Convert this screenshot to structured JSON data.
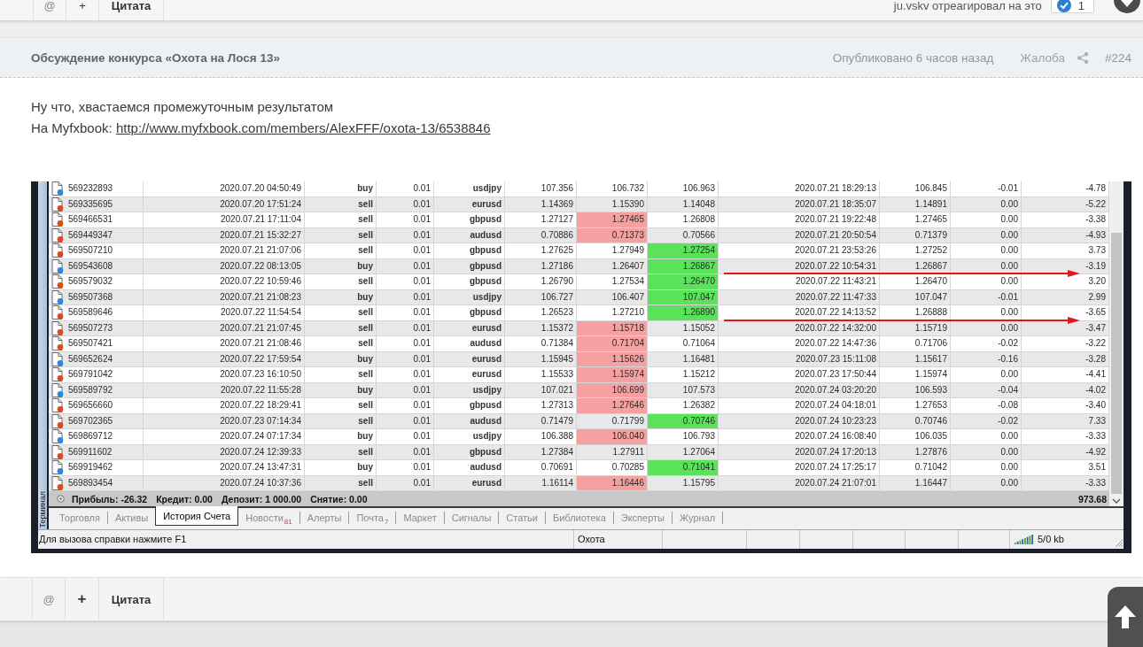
{
  "top_bar": {
    "buttons": [
      "@",
      "+",
      "Цитата"
    ],
    "reaction_text": "ju.vskv отреагировал на это",
    "reaction_count": "1"
  },
  "post": {
    "title": "Обсуждение конкурса «Охота на Лося 13»",
    "published": "Опубликовано 6 часов назад",
    "report_link": "Жалоба",
    "post_number": "#224",
    "paragraphs": [
      {
        "text": "Ну что, хвастаемся промежуточным результатом"
      },
      {
        "text": "На Myfxbook:",
        "link": "http://www.myfxbook.com/members/AlexFFF/oxota-13/6538846"
      }
    ]
  },
  "terminal": {
    "side_label": "Терминал",
    "rows": [
      {
        "kind": "buy",
        "cells": [
          "569232893",
          "2020.07.20 04:50:49",
          "buy",
          "0.01",
          "usdjpy",
          "107.356",
          "106.732",
          "106.963",
          "2020.07.21 18:29:13",
          "106.845",
          "-0.01",
          "-4.78"
        ],
        "column_7_highlighted": false,
        "column_8_highlighted": false,
        "arrow": false
      },
      {
        "kind": "sell",
        "cells": [
          "569335695",
          "2020.07.20 17:51:24",
          "sell",
          "0.01",
          "eurusd",
          "1.14369",
          "1.15390",
          "1.14048",
          "2020.07.21 18:35:07",
          "1.14891",
          "0.00",
          "-5.22"
        ],
        "column_7_highlighted": false,
        "column_8_highlighted": false,
        "arrow": false
      },
      {
        "kind": "sell",
        "cells": [
          "569466531",
          "2020.07.21 17:11:04",
          "sell",
          "0.01",
          "gbpusd",
          "1.27127",
          "1.27465",
          "1.26808",
          "2020.07.21 19:22:48",
          "1.27465",
          "0.00",
          "-3.38"
        ],
        "column_7_highlighted": true,
        "column_8_highlighted": false,
        "arrow": false
      },
      {
        "kind": "sell",
        "cells": [
          "569449347",
          "2020.07.21 15:32:27",
          "sell",
          "0.01",
          "audusd",
          "0.70886",
          "0.71373",
          "0.70566",
          "2020.07.21 20:50:54",
          "0.71379",
          "0.00",
          "-4.93"
        ],
        "column_7_highlighted": true,
        "column_8_highlighted": false,
        "arrow": false
      },
      {
        "kind": "sell",
        "cells": [
          "569507210",
          "2020.07.21 21:07:06",
          "sell",
          "0.01",
          "gbpusd",
          "1.27625",
          "1.27949",
          "1.27254",
          "2020.07.21 23:53:26",
          "1.27252",
          "0.00",
          "3.73"
        ],
        "column_7_highlighted": false,
        "column_8_highlighted": true,
        "arrow": false
      },
      {
        "kind": "buy",
        "cells": [
          "569543608",
          "2020.07.22 08:13:05",
          "buy",
          "0.01",
          "gbpusd",
          "1.27186",
          "1.26407",
          "1.26867",
          "2020.07.22 10:54:31",
          "1.26867",
          "0.00",
          "-3.19"
        ],
        "column_7_highlighted": false,
        "column_8_highlighted": true,
        "arrow": true
      },
      {
        "kind": "sell",
        "cells": [
          "569579032",
          "2020.07.22 10:59:46",
          "sell",
          "0.01",
          "gbpusd",
          "1.26790",
          "1.27534",
          "1.26470",
          "2020.07.22 11:43:21",
          "1.26470",
          "0.00",
          "3.20"
        ],
        "column_7_highlighted": false,
        "column_8_highlighted": true,
        "arrow": false
      },
      {
        "kind": "buy",
        "cells": [
          "569507368",
          "2020.07.21 21:08:23",
          "buy",
          "0.01",
          "usdjpy",
          "106.727",
          "106.407",
          "107.047",
          "2020.07.22 11:47:33",
          "107.047",
          "-0.01",
          "2.99"
        ],
        "column_7_highlighted": false,
        "column_8_highlighted": true,
        "arrow": false
      },
      {
        "kind": "sell",
        "cells": [
          "569589646",
          "2020.07.22 11:54:54",
          "sell",
          "0.01",
          "gbpusd",
          "1.26523",
          "1.27210",
          "1.26890",
          "2020.07.22 14:13:52",
          "1.26888",
          "0.00",
          "-3.65"
        ],
        "column_7_highlighted": false,
        "column_8_highlighted": true,
        "arrow": true
      },
      {
        "kind": "sell",
        "cells": [
          "569507273",
          "2020.07.21 21:07:45",
          "sell",
          "0.01",
          "eurusd",
          "1.15372",
          "1.15718",
          "1.15052",
          "2020.07.22 14:32:00",
          "1.15719",
          "0.00",
          "-3.47"
        ],
        "column_7_highlighted": true,
        "column_8_highlighted": false,
        "arrow": false
      },
      {
        "kind": "sell",
        "cells": [
          "569507421",
          "2020.07.21 21:08:46",
          "sell",
          "0.01",
          "audusd",
          "0.71384",
          "0.71704",
          "0.71064",
          "2020.07.22 14:47:36",
          "0.71706",
          "-0.02",
          "-3.22"
        ],
        "column_7_highlighted": true,
        "column_8_highlighted": false,
        "arrow": false
      },
      {
        "kind": "buy",
        "cells": [
          "569652624",
          "2020.07.22 17:59:54",
          "buy",
          "0.01",
          "eurusd",
          "1.15945",
          "1.15626",
          "1.16481",
          "2020.07.23 15:11:08",
          "1.15617",
          "-0.16",
          "-3.28"
        ],
        "column_7_highlighted": true,
        "column_8_highlighted": false,
        "arrow": false
      },
      {
        "kind": "sell",
        "cells": [
          "569791042",
          "2020.07.23 16:10:50",
          "sell",
          "0.01",
          "eurusd",
          "1.15533",
          "1.15974",
          "1.15212",
          "2020.07.23 17:50:44",
          "1.15974",
          "0.00",
          "-4.41"
        ],
        "column_7_highlighted": true,
        "column_8_highlighted": false,
        "arrow": false
      },
      {
        "kind": "buy",
        "cells": [
          "569589792",
          "2020.07.22 11:55:28",
          "buy",
          "0.01",
          "usdjpy",
          "107.021",
          "106.699",
          "107.573",
          "2020.07.24 03:20:20",
          "106.593",
          "-0.04",
          "-4.02"
        ],
        "column_7_highlighted": true,
        "column_8_highlighted": false,
        "arrow": false
      },
      {
        "kind": "sell",
        "cells": [
          "569656660",
          "2020.07.22 18:29:41",
          "sell",
          "0.01",
          "gbpusd",
          "1.27313",
          "1.27646",
          "1.26382",
          "2020.07.24 04:18:01",
          "1.27653",
          "-0.08",
          "-3.40"
        ],
        "column_7_highlighted": true,
        "column_8_highlighted": false,
        "arrow": false
      },
      {
        "kind": "sell",
        "cells": [
          "569702365",
          "2020.07.23 07:14:34",
          "sell",
          "0.01",
          "audusd",
          "0.71479",
          "0.71799",
          "0.70746",
          "2020.07.24 10:23:23",
          "0.70746",
          "-0.02",
          "7.33"
        ],
        "column_7_highlighted": false,
        "column_8_highlighted": true,
        "arrow": false
      },
      {
        "kind": "buy",
        "cells": [
          "569869712",
          "2020.07.24 07:17:34",
          "buy",
          "0.01",
          "usdjpy",
          "106.388",
          "106.040",
          "106.793",
          "2020.07.24 16:08:40",
          "106.035",
          "0.00",
          "-3.33"
        ],
        "column_7_highlighted": true,
        "column_8_highlighted": false,
        "arrow": false
      },
      {
        "kind": "sell",
        "cells": [
          "569911602",
          "2020.07.24 12:39:33",
          "sell",
          "0.01",
          "gbpusd",
          "1.27384",
          "1.27911",
          "1.27064",
          "2020.07.24 17:20:13",
          "1.27876",
          "0.00",
          "-4.92"
        ],
        "column_7_highlighted": false,
        "column_8_highlighted": false,
        "arrow": false
      },
      {
        "kind": "buy",
        "cells": [
          "569919462",
          "2020.07.24 13:47:31",
          "buy",
          "0.01",
          "audusd",
          "0.70691",
          "0.70285",
          "0.71041",
          "2020.07.24 17:25:17",
          "0.71042",
          "0.00",
          "3.51"
        ],
        "column_7_highlighted": false,
        "column_8_highlighted": true,
        "arrow": false
      },
      {
        "kind": "sell",
        "cells": [
          "569893454",
          "2020.07.24 10:37:36",
          "sell",
          "0.01",
          "eurusd",
          "1.16114",
          "1.16446",
          "1.15795",
          "2020.07.24 21:07:01",
          "1.16447",
          "0.00",
          "-3.33"
        ],
        "column_7_highlighted": true,
        "column_8_highlighted": false,
        "arrow": false
      }
    ],
    "summary": {
      "items": [
        "Прибыль: -26.32",
        "Кредит: 0.00",
        "Депозит: 1 000.00",
        "Снятие: 0.00"
      ],
      "total": "973.68"
    },
    "tabs": [
      {
        "label": "Торговля",
        "selected": false
      },
      {
        "label": "Активы",
        "selected": false
      },
      {
        "label": "История Счета",
        "selected": true
      },
      {
        "label": "Новости",
        "badge": "81",
        "selected": false
      },
      {
        "label": "Алерты",
        "selected": false
      },
      {
        "label": "Почта",
        "badge": "7",
        "selected": false
      },
      {
        "label": "Маркет",
        "selected": false
      },
      {
        "label": "Сигналы",
        "selected": false
      },
      {
        "label": "Статьи",
        "selected": false
      },
      {
        "label": "Библиотека",
        "selected": false
      },
      {
        "label": "Эксперты",
        "selected": false
      },
      {
        "label": "Журнал",
        "selected": false
      }
    ],
    "status_bar": {
      "help_text": "Для вызова справки нажмите F1",
      "profile": "Охота",
      "traffic": "5/0 kb"
    }
  },
  "bottom_bar": {
    "buttons": [
      "@",
      "+",
      "Цитата"
    ]
  }
}
